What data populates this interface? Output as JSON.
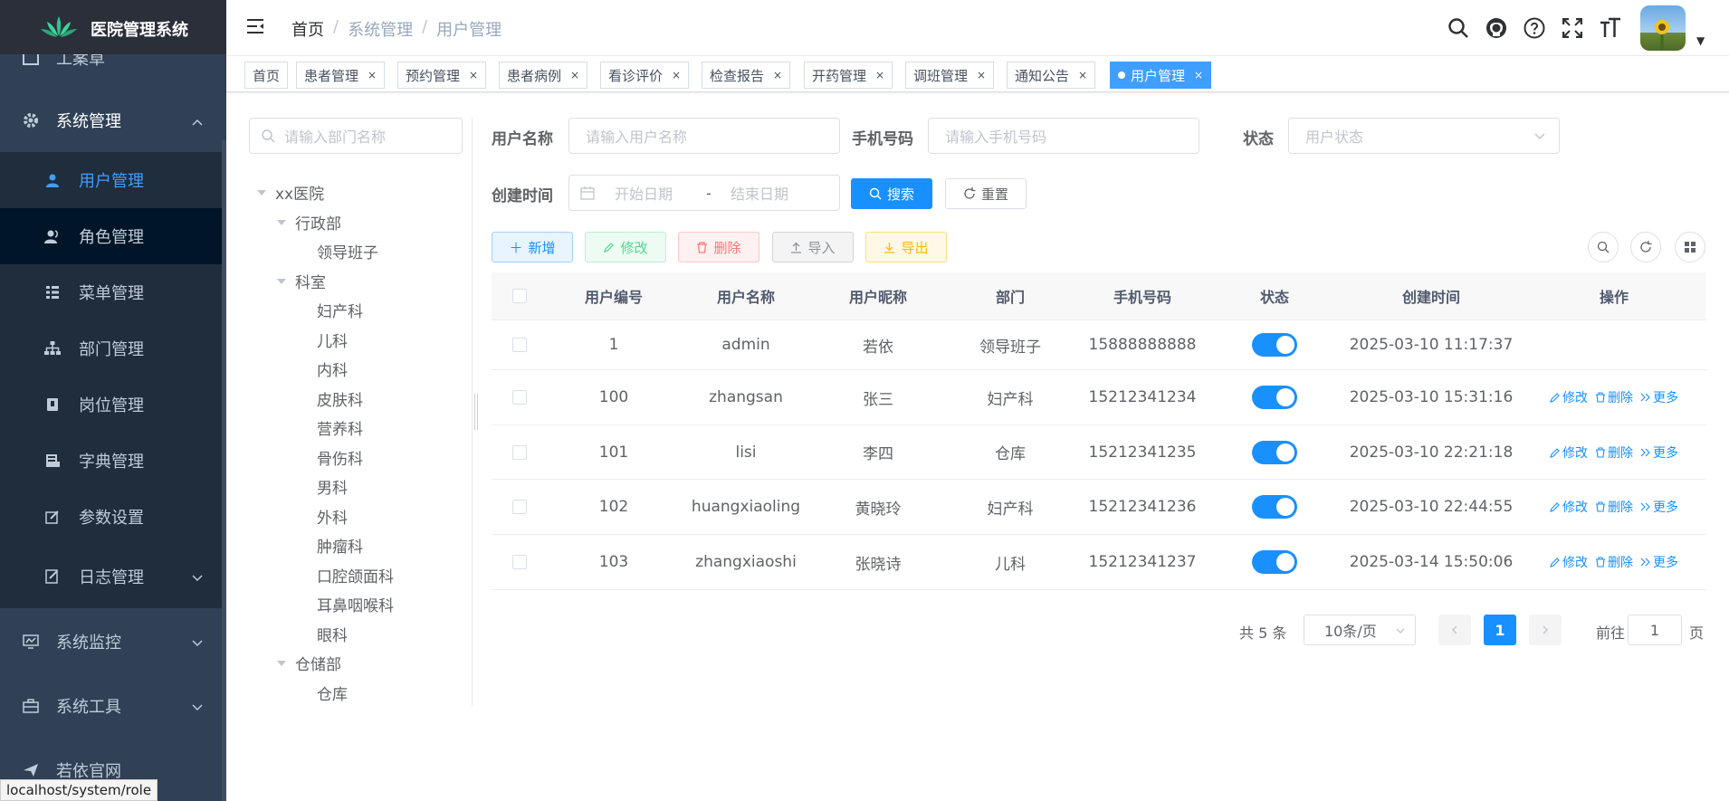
{
  "app": {
    "title": "医院管理系统"
  },
  "sidebar": {
    "partial_top": "工案草",
    "system": "系统管理",
    "items": [
      {
        "label": "用户管理"
      },
      {
        "label": "角色管理"
      },
      {
        "label": "菜单管理"
      },
      {
        "label": "部门管理"
      },
      {
        "label": "岗位管理"
      },
      {
        "label": "字典管理"
      },
      {
        "label": "参数设置"
      },
      {
        "label": "日志管理"
      }
    ],
    "monitor": "系统监控",
    "tools": "系统工具",
    "official": "若依官网"
  },
  "status_url": "localhost/system/role",
  "breadcrumb": {
    "home": "首页",
    "sep": "/",
    "parent": "系统管理",
    "current": "用户管理"
  },
  "tags": [
    {
      "label": "首页"
    },
    {
      "label": "患者管理"
    },
    {
      "label": "预约管理"
    },
    {
      "label": "患者病例"
    },
    {
      "label": "看诊评价"
    },
    {
      "label": "检查报告"
    },
    {
      "label": "开药管理"
    },
    {
      "label": "调班管理"
    },
    {
      "label": "通知公告"
    },
    {
      "label": "用户管理"
    }
  ],
  "tag_close": "×",
  "dept": {
    "placeholder": "请输入部门名称",
    "tree": {
      "root": "xx医院",
      "admin": "行政部",
      "leaders": "领导班子",
      "clinic": "科室",
      "clinics": [
        "妇产科",
        "儿科",
        "内科",
        "皮肤科",
        "营养科",
        "骨伤科",
        "男科",
        "外科",
        "肿瘤科",
        "口腔颌面科",
        "耳鼻咽喉科",
        "眼科"
      ],
      "storage": "仓储部",
      "warehouse": "仓库"
    }
  },
  "form": {
    "username_label": "用户名称",
    "username_placeholder": "请输入用户名称",
    "phone_label": "手机号码",
    "phone_placeholder": "请输入手机号码",
    "status_label": "状态",
    "status_placeholder": "用户状态",
    "created_label": "创建时间",
    "start_placeholder": "开始日期",
    "range_sep": "-",
    "end_placeholder": "结束日期",
    "search": "搜索",
    "reset": "重置"
  },
  "toolbar": {
    "add": "新增",
    "edit": "修改",
    "delete": "删除",
    "import": "导入",
    "export": "导出"
  },
  "table": {
    "headers": [
      "用户编号",
      "用户名称",
      "用户昵称",
      "部门",
      "手机号码",
      "状态",
      "创建时间",
      "操作"
    ],
    "rows": [
      {
        "id": "1",
        "username": "admin",
        "nickname": "若依",
        "dept": "领导班子",
        "phone": "15888888888",
        "enabled": true,
        "created": "2025-03-10 11:17:37"
      },
      {
        "id": "100",
        "username": "zhangsan",
        "nickname": "张三",
        "dept": "妇产科",
        "phone": "15212341234",
        "enabled": true,
        "created": "2025-03-10 15:31:16"
      },
      {
        "id": "101",
        "username": "lisi",
        "nickname": "李四",
        "dept": "仓库",
        "phone": "15212341235",
        "enabled": true,
        "created": "2025-03-10 22:21:18"
      },
      {
        "id": "102",
        "username": "huangxiaoling",
        "nickname": "黄晓玲",
        "dept": "妇产科",
        "phone": "15212341236",
        "enabled": true,
        "created": "2025-03-10 22:44:55"
      },
      {
        "id": "103",
        "username": "zhangxiaoshi",
        "nickname": "张晓诗",
        "dept": "儿科",
        "phone": "15212341237",
        "enabled": true,
        "created": "2025-03-14 15:50:06"
      }
    ],
    "ops": {
      "edit": "修改",
      "delete": "删除",
      "more": "更多"
    }
  },
  "pagination": {
    "total": "共 5 条",
    "page_size": "10条/页",
    "current": "1",
    "goto_label": "前往",
    "goto_value": "1",
    "page_unit": "页"
  },
  "colors": {
    "primary": "#1890ff",
    "sidebar_bg": "#304156",
    "submenu_bg": "#1f2d3d",
    "active_text": "#409eff"
  }
}
